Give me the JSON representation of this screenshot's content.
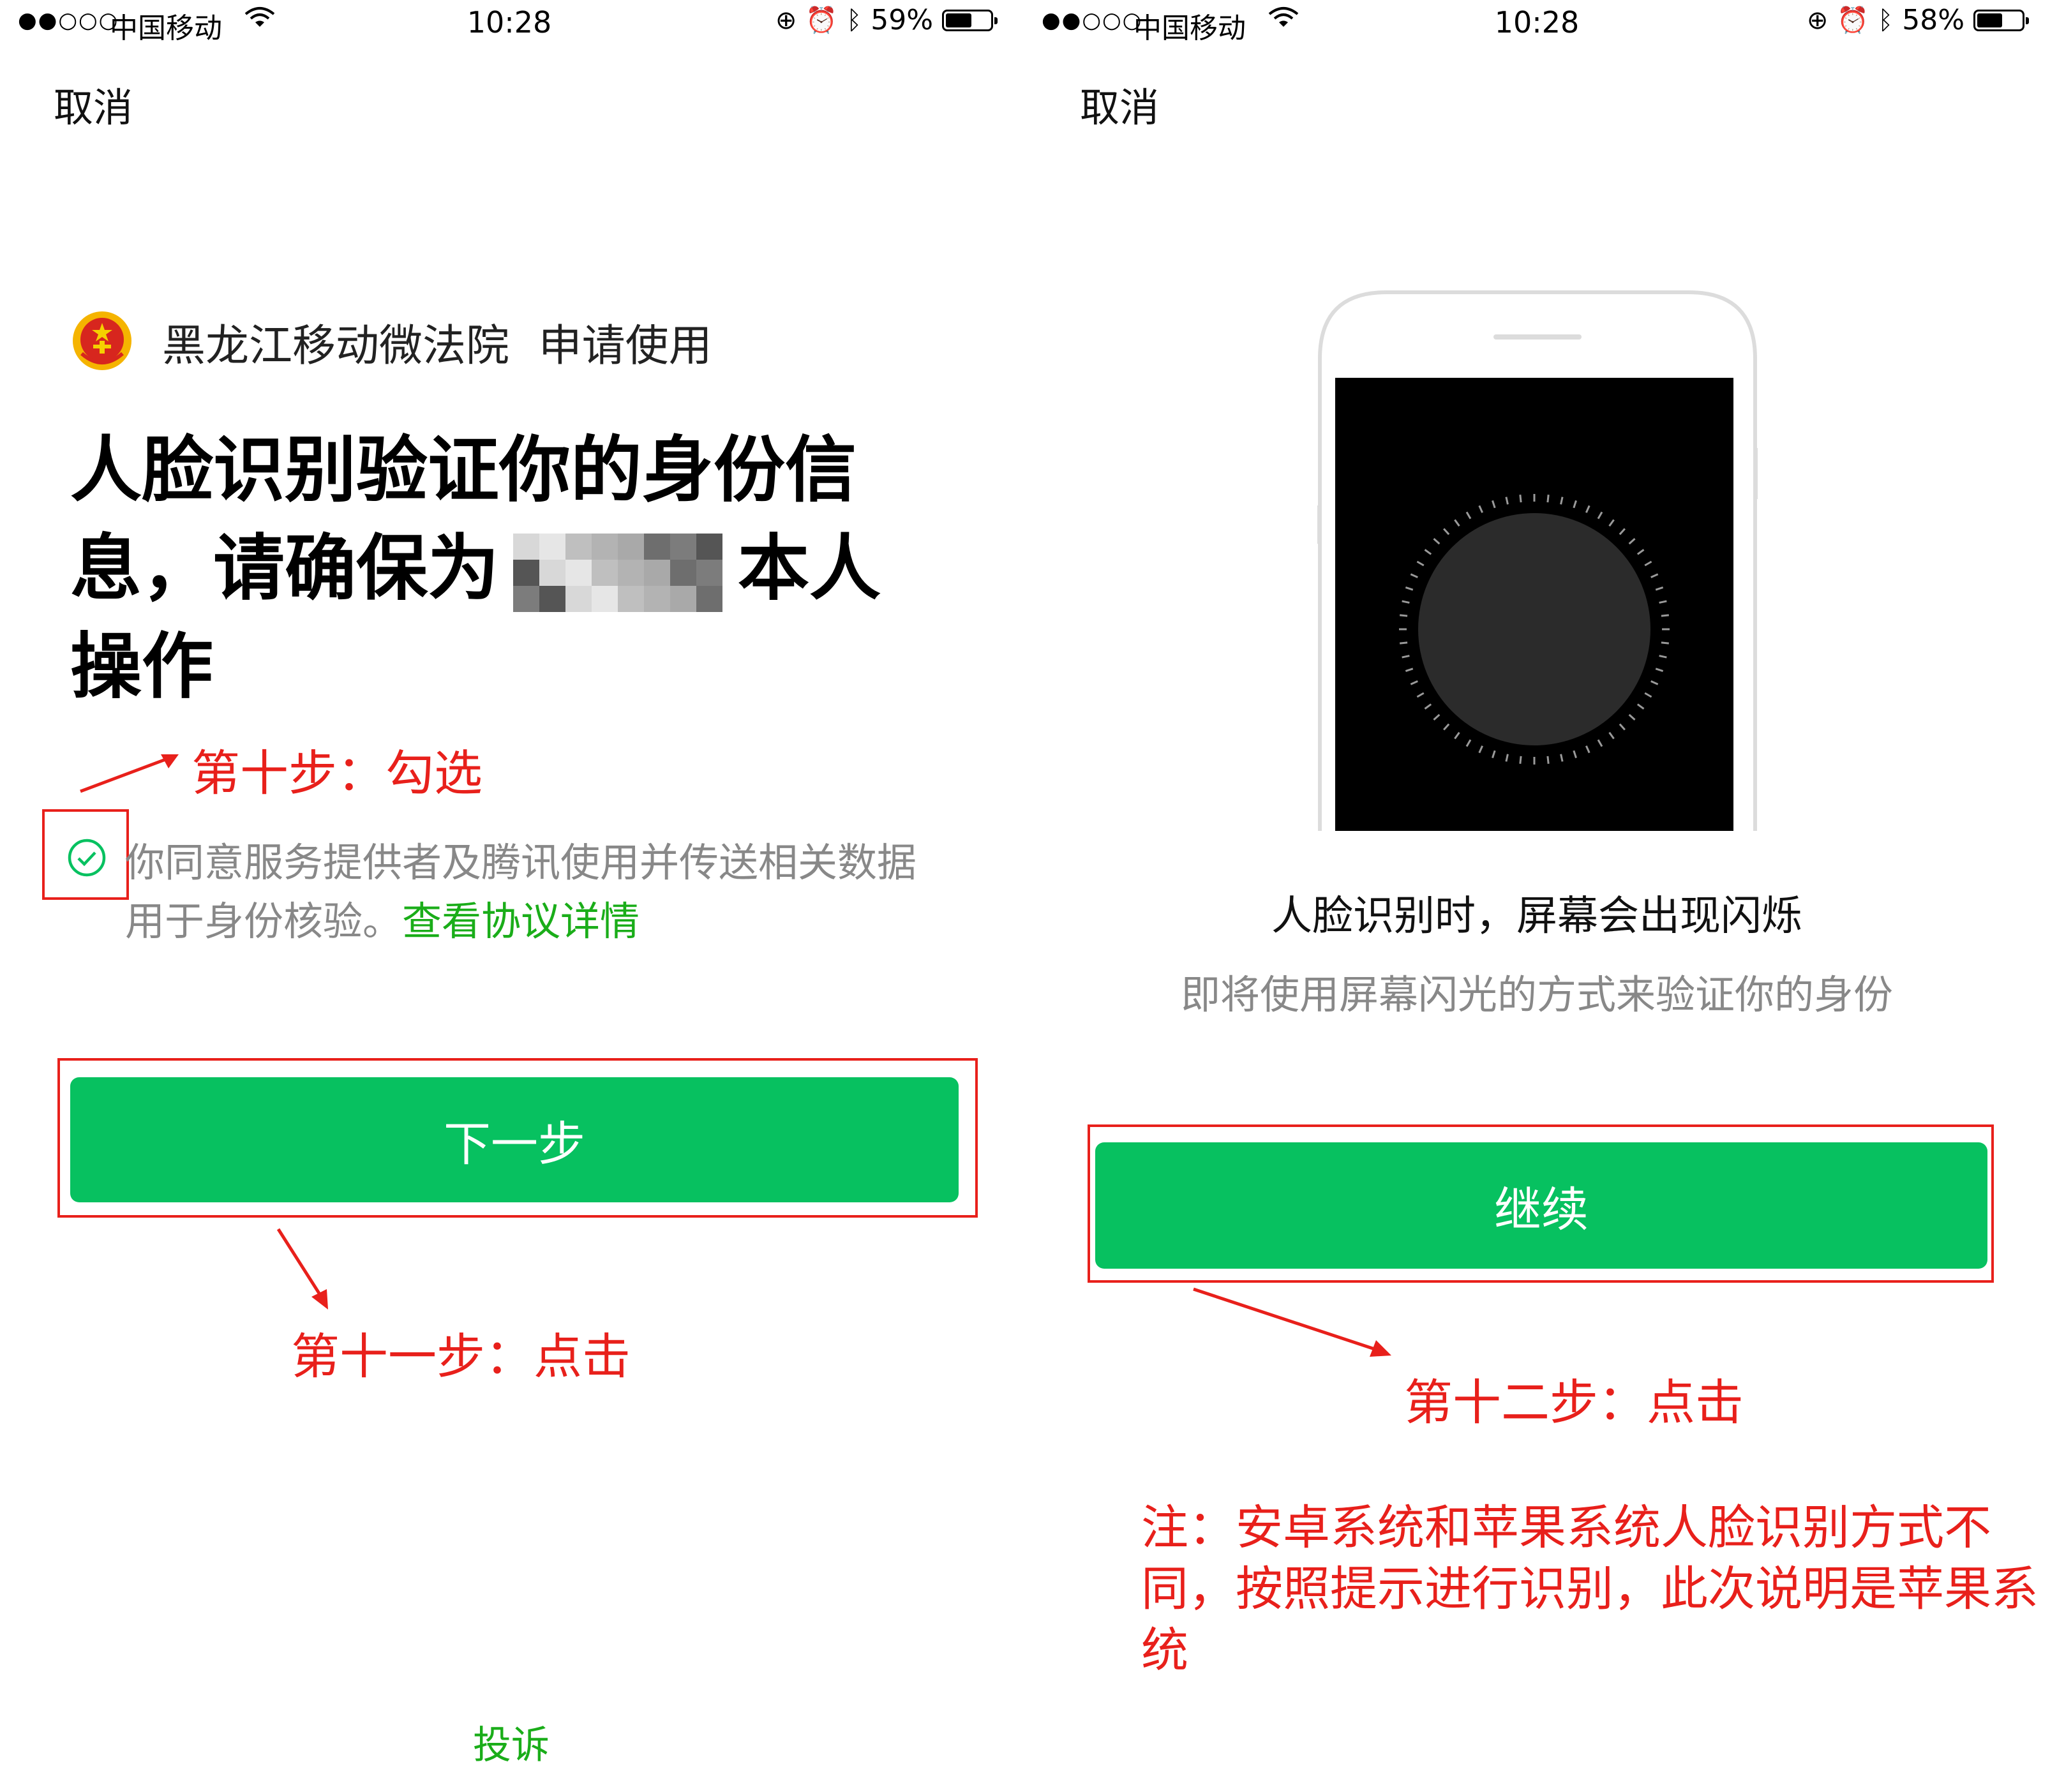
{
  "left": {
    "status_bar": {
      "signal": "●●○○○",
      "carrier": "中国移动",
      "time": "10:28",
      "battery_pct": "59%",
      "battery_level": 0.59
    },
    "nav": {
      "cancel_label": "取消"
    },
    "app_line": {
      "name": "黑龙江移动微法院",
      "action": "申请使用"
    },
    "headline": {
      "part1": "人脸识别验证你的身份信",
      "part2": "息，请确保为",
      "part3": "本人",
      "part4": "操作"
    },
    "consent": {
      "text1": "你同意服务提供者及腾讯使用并传送相关数据",
      "text2": "用于身份核验。",
      "link": "查看协议详情"
    },
    "next_button_label": "下一步",
    "complaint_link": "投诉",
    "annotations": {
      "step10": "第十步：勾选",
      "step11": "第十一步：点击"
    }
  },
  "right": {
    "status_bar": {
      "signal": "●●○○○",
      "carrier": "中国移动",
      "time": "10:28",
      "battery_pct": "58%",
      "battery_level": 0.58
    },
    "nav": {
      "cancel_label": "取消"
    },
    "flash_title": "人脸识别时，屏幕会出现闪烁",
    "flash_subtitle": "即将使用屏幕闪光的方式来验证你的身份",
    "continue_button_label": "继续",
    "annotations": {
      "step12": "第十二步：点击",
      "note_line1": "注：安卓系统和苹果系统人脸识别方式不",
      "note_line2": "同，按照提示进行识别，此次说明是苹果系",
      "note_line3": "统"
    }
  },
  "colors": {
    "accent_green": "#07c160",
    "link_green": "#1aad19",
    "annotation_red": "#e8201b",
    "secondary_text": "#888888"
  }
}
